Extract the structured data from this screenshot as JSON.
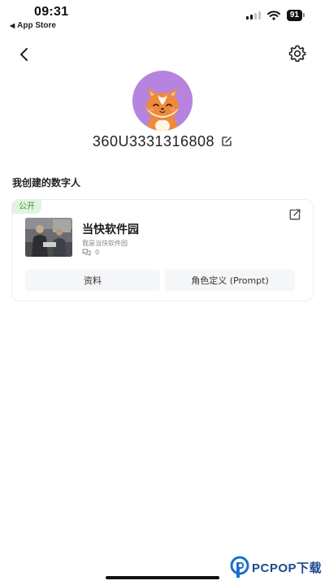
{
  "status_bar": {
    "time": "09:31",
    "back_app": "App Store",
    "battery": "91"
  },
  "nav": {
    "back_icon": "chevron-left-icon",
    "settings_icon": "gear-icon"
  },
  "profile": {
    "avatar_icon": "fox-avatar",
    "username": "360U3331316808"
  },
  "section": {
    "title": "我创建的数字人"
  },
  "card": {
    "badge": "公开",
    "name": "当快软件园",
    "description": "我是当快软件园",
    "chat_count": "0",
    "buttons": {
      "profile": "资料",
      "prompt": "角色定义 (Prompt)"
    }
  },
  "watermark": {
    "text": "PCPOP下载"
  },
  "colors": {
    "avatar_bg": "#b684de",
    "badge_bg": "#dff5de",
    "badge_text": "#3a9a3a",
    "button_bg": "#f5f6f8"
  }
}
